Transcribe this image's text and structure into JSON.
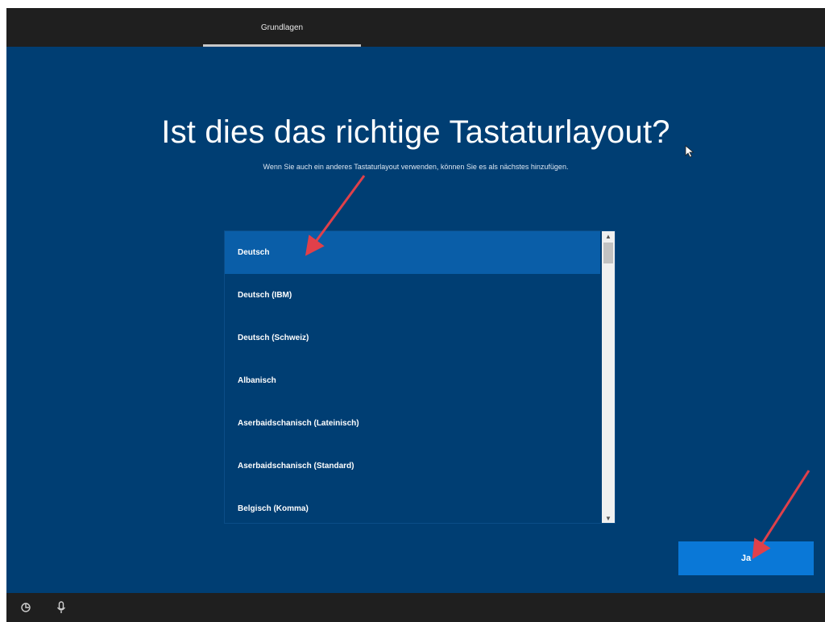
{
  "topbar": {
    "tab_label": "Grundlagen"
  },
  "main": {
    "title": "Ist dies das richtige Tastaturlayout?",
    "subtitle": "Wenn Sie auch ein anderes Tastaturlayout verwenden, können Sie es als nächstes hinzufügen."
  },
  "layout_list": {
    "selected_index": 0,
    "items": [
      {
        "label": "Deutsch"
      },
      {
        "label": "Deutsch (IBM)"
      },
      {
        "label": "Deutsch (Schweiz)"
      },
      {
        "label": "Albanisch"
      },
      {
        "label": "Aserbaidschanisch (Lateinisch)"
      },
      {
        "label": "Aserbaidschanisch (Standard)"
      },
      {
        "label": "Belgisch (Komma)"
      }
    ]
  },
  "actions": {
    "yes_label": "Ja"
  },
  "bottombar": {
    "icons": [
      "accessibility-icon",
      "microphone-icon"
    ]
  },
  "colors": {
    "background": "#003e73",
    "selection": "#0a5ea8",
    "button": "#0a78d7",
    "chrome": "#1f1f1f",
    "annotation_arrow": "#e0404a"
  }
}
